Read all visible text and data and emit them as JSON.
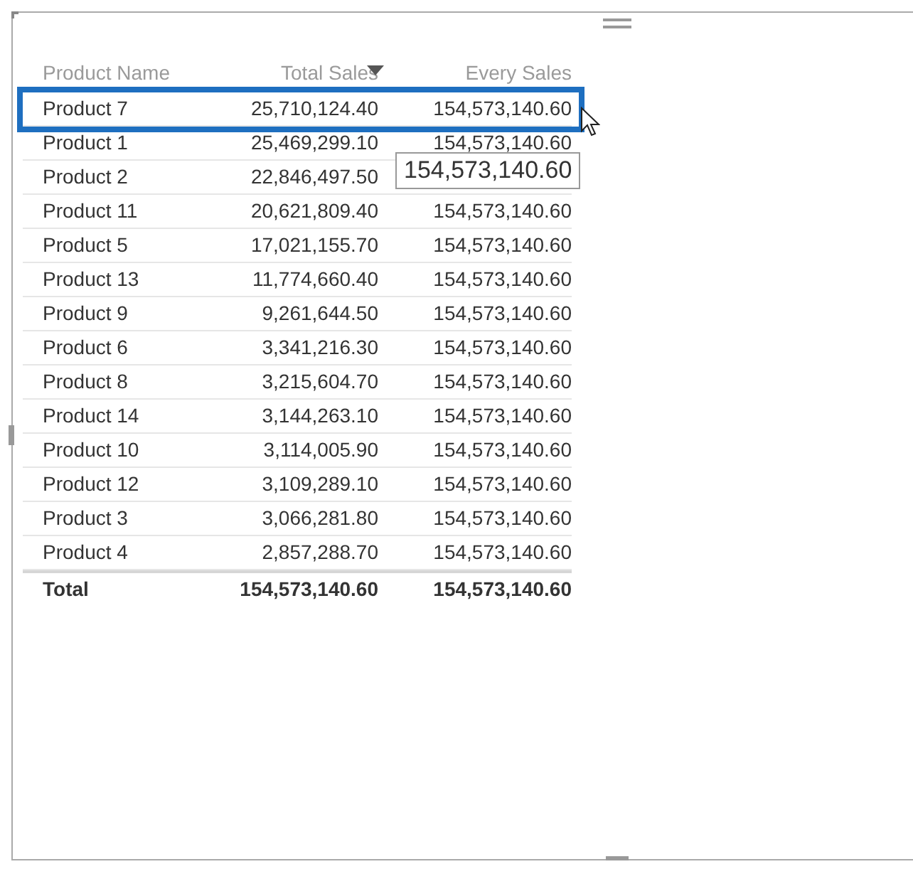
{
  "table": {
    "columns": [
      {
        "label": "Product Name",
        "sorted": false
      },
      {
        "label": "Total Sales",
        "sorted": true
      },
      {
        "label": "Every Sales",
        "sorted": false
      }
    ],
    "rows": [
      {
        "cells": [
          "Product 7",
          "25,710,124.40",
          "154,573,140.60"
        ],
        "selected": true
      },
      {
        "cells": [
          "Product 1",
          "25,469,299.10",
          "154,573,140.60"
        ],
        "selected": false
      },
      {
        "cells": [
          "Product 2",
          "22,846,497.50"
        ],
        "selected": false
      },
      {
        "cells": [
          "Product 11",
          "20,621,809.40",
          "154,573,140.60"
        ],
        "selected": false
      },
      {
        "cells": [
          "Product 5",
          "17,021,155.70",
          "154,573,140.60"
        ],
        "selected": false
      },
      {
        "cells": [
          "Product 13",
          "11,774,660.40",
          "154,573,140.60"
        ],
        "selected": false
      },
      {
        "cells": [
          "Product 9",
          "9,261,644.50",
          "154,573,140.60"
        ],
        "selected": false
      },
      {
        "cells": [
          "Product 6",
          "3,341,216.30",
          "154,573,140.60"
        ],
        "selected": false
      },
      {
        "cells": [
          "Product 8",
          "3,215,604.70",
          "154,573,140.60"
        ],
        "selected": false
      },
      {
        "cells": [
          "Product 14",
          "3,144,263.10",
          "154,573,140.60"
        ],
        "selected": false
      },
      {
        "cells": [
          "Product 10",
          "3,114,005.90",
          "154,573,140.60"
        ],
        "selected": false
      },
      {
        "cells": [
          "Product 12",
          "3,109,289.10",
          "154,573,140.60"
        ],
        "selected": false
      },
      {
        "cells": [
          "Product 3",
          "3,066,281.80",
          "154,573,140.60"
        ],
        "selected": false
      },
      {
        "cells": [
          "Product 4",
          "2,857,288.70",
          "154,573,140.60"
        ],
        "selected": false
      }
    ],
    "total": [
      "Total",
      "154,573,140.60",
      "154,573,140.60"
    ]
  },
  "tooltip": {
    "text": "154,573,140.60"
  }
}
